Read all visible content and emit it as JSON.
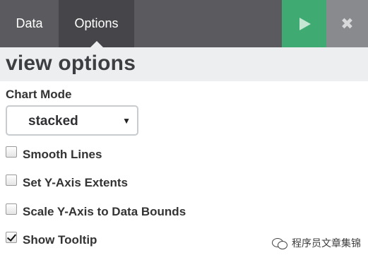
{
  "tabs": {
    "data_label": "Data",
    "options_label": "Options"
  },
  "toolbar": {
    "run_icon": "play-icon",
    "close_icon": "close-icon",
    "close_glyph": "✖"
  },
  "panel": {
    "title": "view options",
    "chart_mode": {
      "label": "Chart Mode",
      "selected": "stacked"
    },
    "options": [
      {
        "label": "Smooth Lines",
        "checked": false
      },
      {
        "label": "Set Y-Axis Extents",
        "checked": false
      },
      {
        "label": "Scale Y-Axis to Data Bounds",
        "checked": false
      },
      {
        "label": "Show Tooltip",
        "checked": true
      }
    ]
  },
  "watermark": {
    "text": "程序员文章集锦"
  },
  "colors": {
    "topbar": "#5a5a5f",
    "active_tab": "#45454a",
    "run_button": "#3faa72",
    "close_button": "#888a8d",
    "header_band": "#eceeef"
  }
}
